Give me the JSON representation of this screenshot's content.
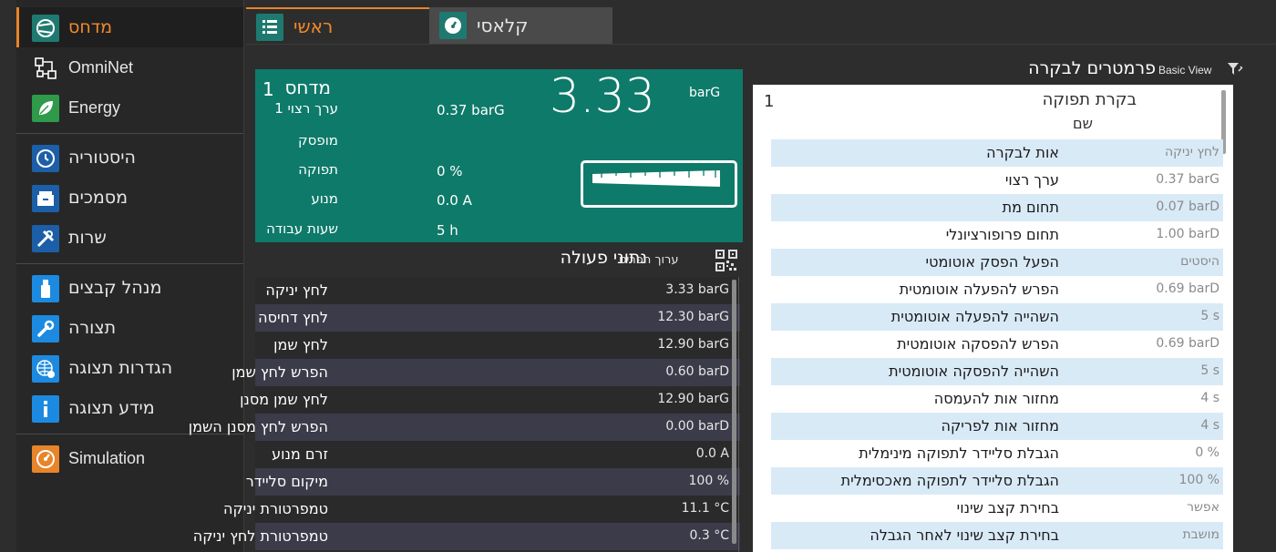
{
  "colors": {
    "accent": "#e8842a",
    "teal": "#0e7a6a",
    "sidebar_bg": "#272727",
    "highlight_row": "#d9eaf7"
  },
  "sidebar": {
    "groups": [
      {
        "items": [
          {
            "label": "מדחס",
            "icon": "compressor-icon",
            "active": true
          },
          {
            "label": "OmniNet",
            "icon": "network-icon"
          },
          {
            "label": "Energy",
            "icon": "leaf-icon"
          }
        ]
      },
      {
        "items": [
          {
            "label": "היסטוריה",
            "icon": "history-icon"
          },
          {
            "label": "מסמכים",
            "icon": "documents-icon"
          },
          {
            "label": "שרות",
            "icon": "service-tools-icon"
          }
        ]
      },
      {
        "items": [
          {
            "label": "מנהל קבצים",
            "icon": "usb-drive-icon"
          },
          {
            "label": "תצורה",
            "icon": "wrench-icon"
          },
          {
            "label": "הגדרות תצוגה",
            "icon": "display-settings-icon"
          },
          {
            "label": "מידע תצוגה",
            "icon": "info-icon"
          }
        ]
      },
      {
        "items": [
          {
            "label": "Simulation",
            "icon": "gauge-icon"
          }
        ]
      }
    ]
  },
  "tabs": {
    "main": {
      "label": "ראשי",
      "icon": "list-icon"
    },
    "classic": {
      "label": "קלאסי",
      "icon": "dial-icon"
    }
  },
  "summary": {
    "title": "מדחס",
    "title_num": "1",
    "big_value": "3.33",
    "big_unit": "barG",
    "rows": [
      {
        "label": "ערך רצוי 1",
        "value": "0.37 barG"
      },
      {
        "label": "מופסק",
        "value": ""
      },
      {
        "label": "תפוקה",
        "value": "0 %"
      },
      {
        "label": "מנוע",
        "value": "0.0 A"
      },
      {
        "label": "שעות עבודה",
        "value": "5 h"
      }
    ]
  },
  "operational": {
    "title": "נתוני פעולה",
    "detail_link": "ערוך תפריט",
    "rows": [
      {
        "label": "לחץ יניקה",
        "value": "3.33 barG"
      },
      {
        "label": "לחץ דחיסה",
        "value": "12.30 barG"
      },
      {
        "label": "לחץ שמן",
        "value": "12.90 barG"
      },
      {
        "label": "הפרש לחץ שמן",
        "value": "0.60 barD"
      },
      {
        "label": "לחץ שמן מסנן",
        "value": "12.90 barG"
      },
      {
        "label": "הפרש לחץ מסנן השמן",
        "value": "0.00 barD"
      },
      {
        "label": "זרם מנוע",
        "value": "0.0 A"
      },
      {
        "label": "מיקום סליידר",
        "value": "100 %"
      },
      {
        "label": "טמפרטורת יניקה",
        "value": "11.1 °C"
      },
      {
        "label": "טמפרטורת לחץ יניקה",
        "value": "0.3 °C"
      }
    ]
  },
  "params": {
    "title": "פרמטרים לבקרה",
    "basic_view": "Basic View",
    "group_title": "בקרת תפוקה",
    "group_num": "1",
    "group_sub": "שם",
    "rows": [
      {
        "label": "אות לבקרה",
        "value": "לחץ יניקה"
      },
      {
        "label": "ערך רצוי",
        "value": "0.37 barG"
      },
      {
        "label": "תחום מת",
        "value": "0.07 barD"
      },
      {
        "label": "תחום פרופורציונלי",
        "value": "1.00 barD"
      },
      {
        "label": "הפעל הפסק אוטומטי",
        "value": "היסטים"
      },
      {
        "label": "הפרש להפעלה אוטומטית",
        "value": "0.69 barD"
      },
      {
        "label": "השהייה להפעלה אוטומטית",
        "value": "5 s"
      },
      {
        "label": "הפרש להפסקה אוטומטית",
        "value": "0.69 barD"
      },
      {
        "label": "השהייה להפסקה אוטומטית",
        "value": "5 s"
      },
      {
        "label": "מחזור אות להעמסה",
        "value": "4 s"
      },
      {
        "label": "מחזור אות לפריקה",
        "value": "4 s"
      },
      {
        "label": "הגבלת סליידר לתפוקה מינימלית",
        "value": "0 %"
      },
      {
        "label": "הגבלת סליידר לתפוקה מאכסימלית",
        "value": "100 %"
      },
      {
        "label": "בחירת קצב שינוי",
        "value": "אפשר"
      },
      {
        "label": "בחירת קצב שינוי לאחר הגבלה",
        "value": "מושבת"
      }
    ]
  }
}
